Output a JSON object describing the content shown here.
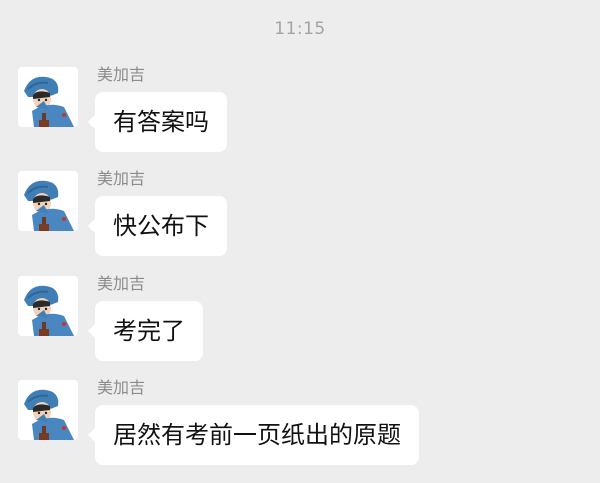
{
  "status": {
    "time": "11:15"
  },
  "messages": [
    {
      "sender": "美加吉",
      "text": "有答案吗"
    },
    {
      "sender": "美加吉",
      "text": "快公布下"
    },
    {
      "sender": "美加吉",
      "text": "考完了"
    },
    {
      "sender": "美加吉",
      "text": "居然有考前一页纸出的原题"
    }
  ],
  "colors": {
    "background": "#ededed",
    "bubble": "#ffffff",
    "sender_text": "#8c8c8c",
    "time_text": "#a3a3a3",
    "avatar_hat": "#3f7fb5",
    "avatar_coat": "#4a86c0"
  },
  "icons": {
    "avatar": "cartoon-person-avatar-icon"
  }
}
